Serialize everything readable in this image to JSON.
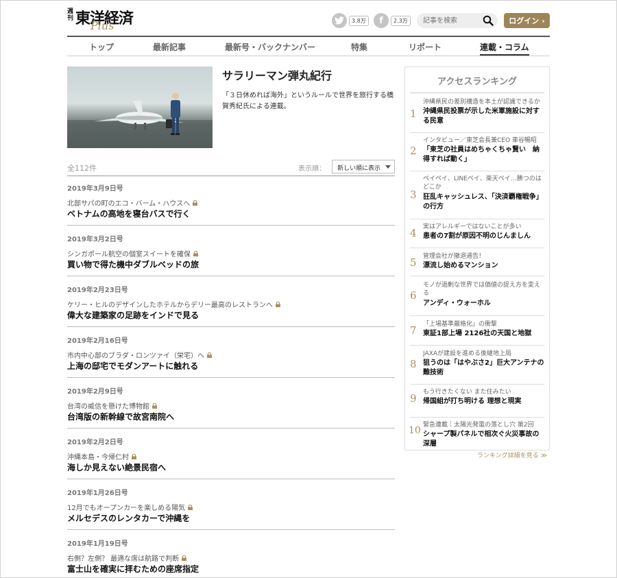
{
  "brand": {
    "small": "週刊",
    "main": "東洋経済",
    "plus": "Plus"
  },
  "social": {
    "twitter": {
      "icon": "twitter-icon",
      "count": "3.8万"
    },
    "facebook": {
      "icon": "facebook-icon",
      "count": "2.3万"
    }
  },
  "search": {
    "placeholder": "記事を検索"
  },
  "login": {
    "label": "ログイン",
    "arrow": "›"
  },
  "nav": {
    "items": [
      "トップ",
      "最新記事",
      "最新号・バックナンバー",
      "特集",
      "リポート",
      "連載・コラム"
    ],
    "active": "連載・コラム"
  },
  "series": {
    "title": "サラリーマン弾丸紀行",
    "description": "「３日休めれば海外」というルールで世界を旅行する橋賀秀紀氏による連載。"
  },
  "list": {
    "total": "全112件",
    "sort_label": "表示順：",
    "sort_value": "新しい順に表示",
    "articles": [
      {
        "date": "2019年3月9日号",
        "sub": "北部サパの町のエコ・バーム・ハウスへ",
        "title": "ベトナムの高地を寝台バスで行く"
      },
      {
        "date": "2019年3月2日号",
        "sub": "シンガポール航空の個室スイートを確保",
        "title": "買い物で得た機中ダブルベッドの旅"
      },
      {
        "date": "2019年2月23日号",
        "sub": "ケリー・ヒルのデザインしたホテルからデリー最高のレストランへ",
        "title": "偉大な建築家の足跡をインドで見る"
      },
      {
        "date": "2019年2月16日号",
        "sub": "市内中心部のブラダ・ロンツァイ（栄宅）へ",
        "title": "上海の邸宅でモダンアートに触れる"
      },
      {
        "date": "2019年2月9日号",
        "sub": "台湾の威信を懸けた博物館",
        "title": "台湾版の新幹線で故宮南院へ"
      },
      {
        "date": "2019年2月2日号",
        "sub": "沖縄本島・今帰仁村",
        "title": "海しか見えない絶景民宿へ"
      },
      {
        "date": "2019年1月26日号",
        "sub": "12月でもオープンカーを楽しめる陽気",
        "title": "メルセデスのレンタカーで沖縄を"
      },
      {
        "date": "2019年1月19日号",
        "sub": "右側？左側？ 最適な席は航路で判断",
        "title": "富士山を確実に拝むための座席指定"
      }
    ]
  },
  "ranking": {
    "heading": "アクセスランキング",
    "items": [
      {
        "num": "1",
        "sub": "沖縄県民の差別構造を本土が認識できるか",
        "title": "沖縄県民投票が示した米軍施設に対する民意"
      },
      {
        "num": "2",
        "sub": "インタビュー／東芝会長兼CEO 車谷暢昭",
        "title": "「東芝の社員はめちゃくちゃ賢い　納得すれば動く」"
      },
      {
        "num": "3",
        "sub": "ペイペイ、LINEペイ、楽天ペイ…勝つのはどこか",
        "title": "狂乱キャッシュレス、「決済覇権戦争」の行方"
      },
      {
        "num": "4",
        "sub": "実はアレルギーではないことが多い",
        "title": "患者の7割が原因不明のじんましん"
      },
      {
        "num": "5",
        "sub": "管理会社が撤退通告！",
        "title": "漂流し始めるマンション"
      },
      {
        "num": "6",
        "sub": "モノが過剰な世界では価値の捉え方を変える",
        "title": "アンディ・ウォーホル"
      },
      {
        "num": "7",
        "sub": "「上場基準厳格化」の衝撃",
        "title": "東証1部上場 2126社の天国と地獄"
      },
      {
        "num": "8",
        "sub": "JAXAが建設を進める後継地上局",
        "title": "狙うのは「はやぶさ2」巨大アンテナの難技術"
      },
      {
        "num": "9",
        "sub": "もう行きたくない また住みたい",
        "title": "帰国組が打ち明ける 理想と現実"
      },
      {
        "num": "10",
        "sub": "緊急連載｜太陽光発電の落とし穴 第2回",
        "title": "シャープ製パネルで相次ぐ火災事故の深層"
      }
    ],
    "more": "ランキング詳細を見る ≫"
  },
  "colors": {
    "accent": "#9c8558",
    "rank_number": "#a89060"
  }
}
